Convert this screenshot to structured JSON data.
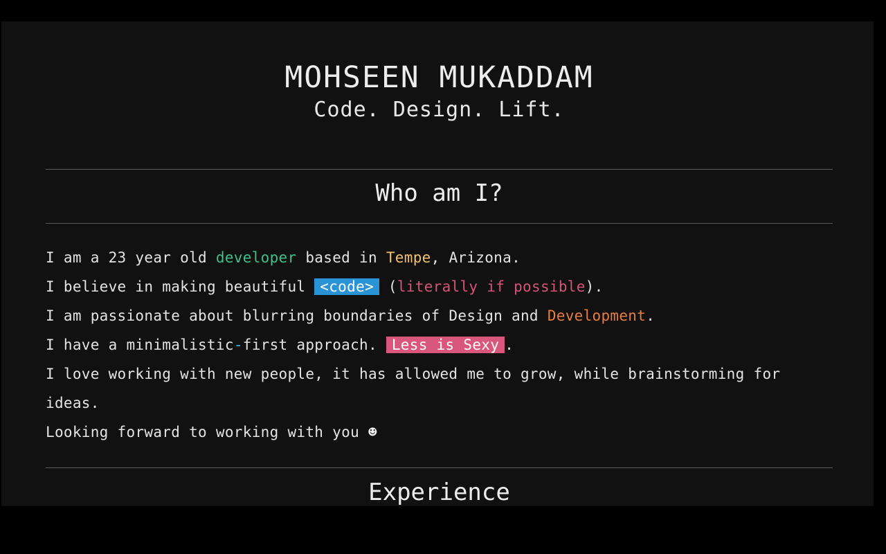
{
  "header": {
    "name": "MOHSEEN MUKADDAM",
    "tagline": "Code. Design. Lift."
  },
  "about": {
    "title": "Who am I?",
    "line1": {
      "a": "I am a 23 year old ",
      "developer": "developer",
      "b": " based in ",
      "city": "Tempe",
      "c": ", Arizona."
    },
    "line2": {
      "a": "I believe in making beautiful ",
      "code": "<code>",
      "b": " (",
      "literally": "literally if possible",
      "c": ")."
    },
    "line3": {
      "a": "I am passionate about blurring boundaries of Design and ",
      "development": "Development",
      "b": "."
    },
    "line4": {
      "a": "I have a minimalistic",
      "dash": "-",
      "b": "first approach. ",
      "badge": "Less is Sexy",
      "c": "."
    },
    "line5": "I love working with new people, it has allowed me to grow, while brainstorming for ideas.",
    "line6": {
      "a": "Looking forward to working with you ",
      "smile": "☻"
    }
  },
  "experience": {
    "title": "Experience"
  },
  "colors": {
    "background": "#111111",
    "green": "#3ec08a",
    "yellow": "#f2c26b",
    "pink": "#d6537a",
    "orange": "#e77d3f",
    "blue_badge": "#2a93d5",
    "pink_badge": "#d9577c"
  }
}
